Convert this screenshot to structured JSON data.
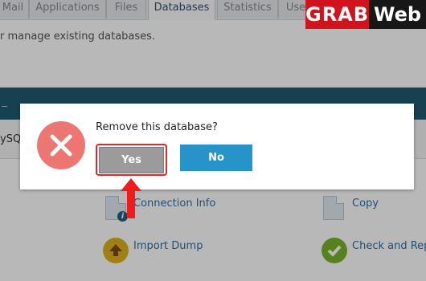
{
  "tabs": [
    {
      "label": "Mail",
      "active": false
    },
    {
      "label": "Applications",
      "active": false
    },
    {
      "label": "Files",
      "active": false
    },
    {
      "label": "Databases",
      "active": true
    },
    {
      "label": "Statistics",
      "active": false
    },
    {
      "label": "Use",
      "active": false
    }
  ],
  "page": {
    "intro_text": "r manage existing databases.",
    "database_name_fragment": "ySQ"
  },
  "actions": {
    "connection_info": "Connection Info",
    "copy": "Copy",
    "import_dump": "Import Dump",
    "check_and_repair": "Check and Repa"
  },
  "dialog": {
    "message": "Remove this database?",
    "yes_label": "Yes",
    "no_label": "No"
  },
  "logo": {
    "part1": "GRAB",
    "part2": "Web"
  },
  "colors": {
    "header_bar": "#1f5a70",
    "danger_icon": "#eb7672",
    "yes_button": "#9b9b9b",
    "no_button": "#2694c9",
    "highlight": "#e8262a"
  }
}
